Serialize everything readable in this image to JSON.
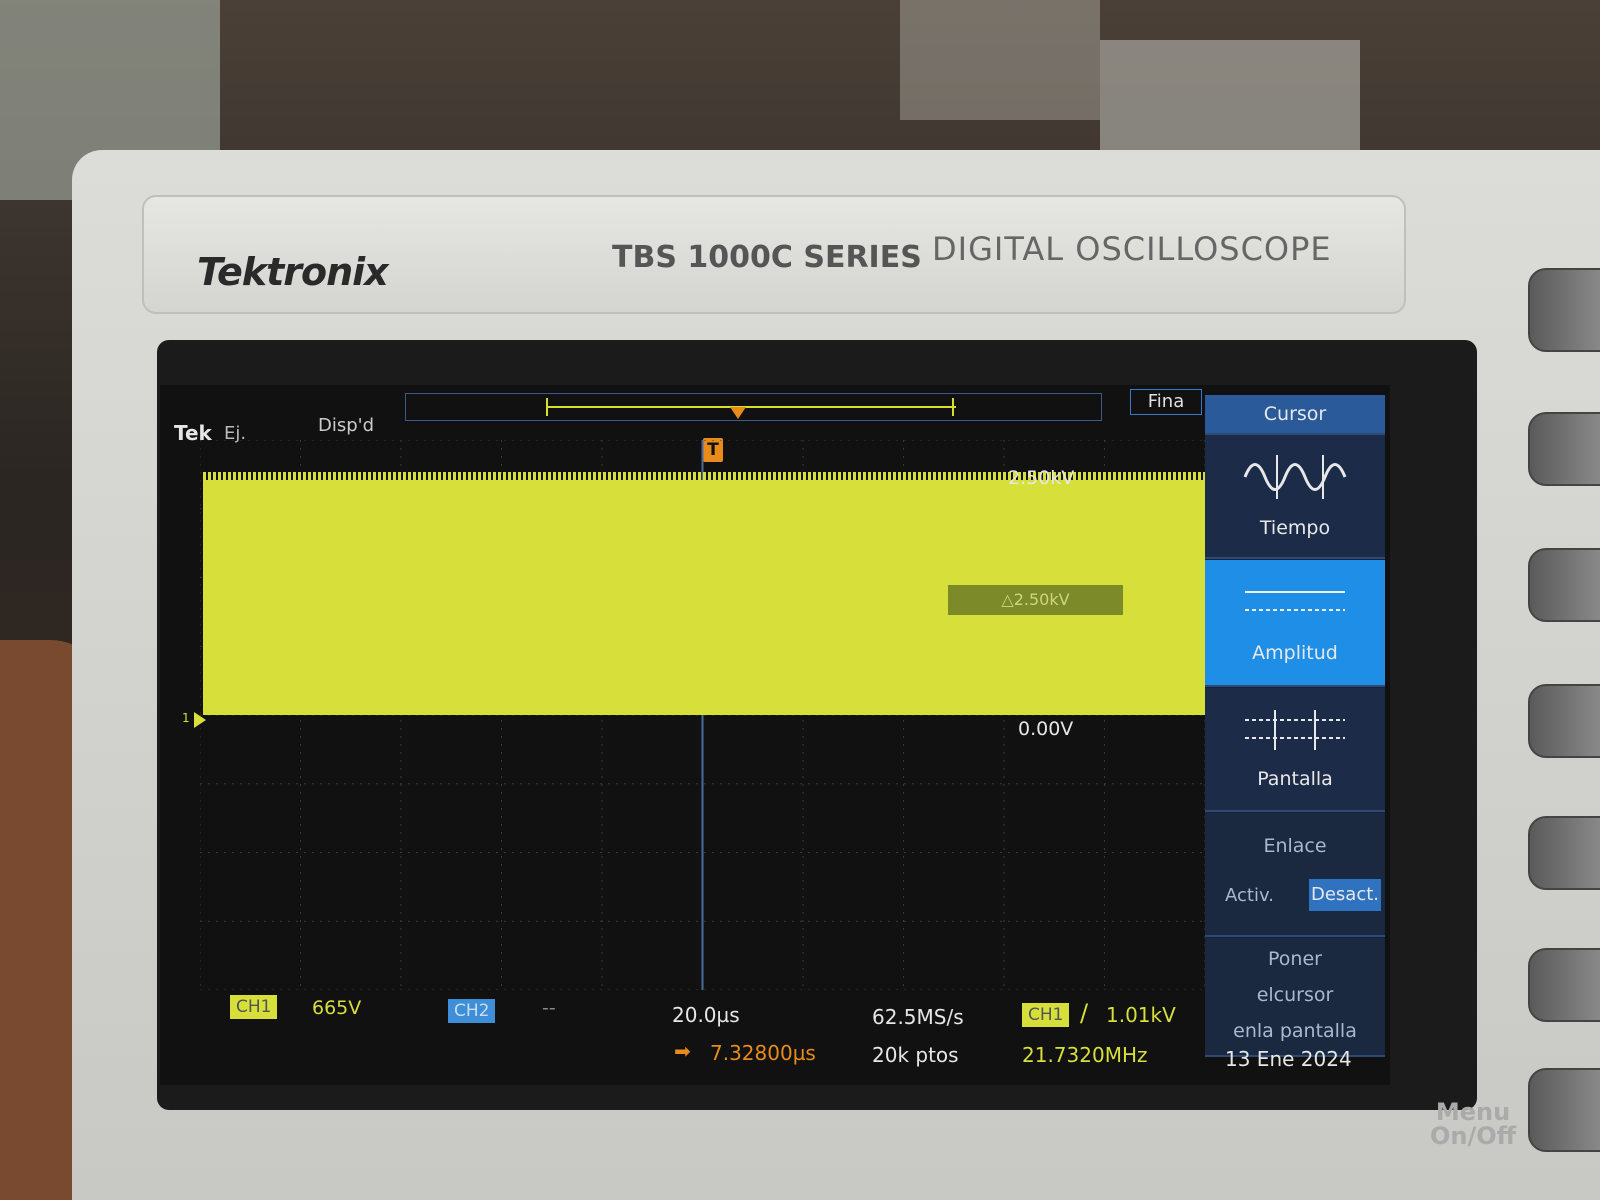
{
  "device": {
    "brand": "Tektronix",
    "series": "TBS 1000C SERIES",
    "subtitle": "DIGITAL OSCILLOSCOPE"
  },
  "top_bar": {
    "tek": "Tek",
    "mode": "Ej.",
    "disp": "Disp'd",
    "fina": "Fina"
  },
  "trigger_marker": "T",
  "waveform": {
    "color": "#d7df3a",
    "cursor_high_label": "2.50kV",
    "cursor_low_label": "0.00V",
    "delta_label": "△2.50kV",
    "ch1_level_marker": "1"
  },
  "menu": {
    "title": "Cursor",
    "items": [
      {
        "label": "Tiempo",
        "icon": "time-cursor-icon"
      },
      {
        "label": "Amplitud",
        "icon": "amplitude-cursor-icon",
        "selected": true
      },
      {
        "label": "Pantalla",
        "icon": "screen-cursor-icon"
      }
    ],
    "enlace": {
      "label": "Enlace",
      "on": "Activ.",
      "off": "Desact."
    },
    "poner": {
      "line1": "Poner",
      "line2": "elcursor",
      "line3": "enla pantalla"
    }
  },
  "status": {
    "ch1_tag": "CH1",
    "ch1_scale": "665V",
    "ch2_tag": "CH2",
    "ch2_scale": "--",
    "timebase": "20.0µs",
    "delay": "7.32800µs",
    "sample_rate": "62.5MS/s",
    "points": "20k ptos",
    "trigger_source": "CH1",
    "trigger_level": "1.01kV",
    "frequency": "21.7320MHz",
    "date": "13 Ene 2024"
  },
  "side_buttons": {
    "menu_onoff_line1": "Menu",
    "menu_onoff_line2": "On/Off"
  }
}
